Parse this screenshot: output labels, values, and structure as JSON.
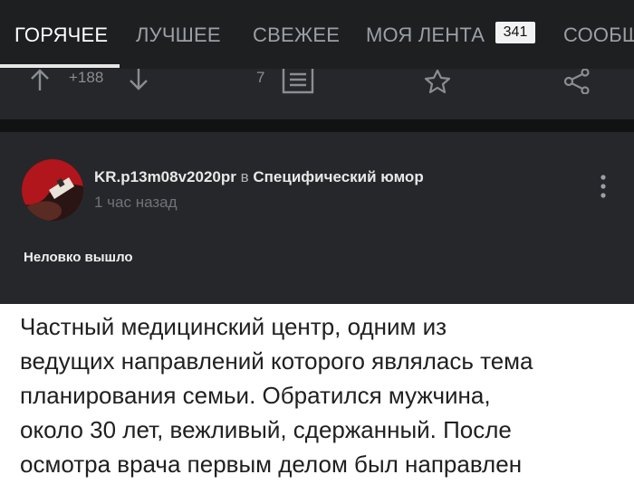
{
  "tabs": [
    {
      "label": "ГОРЯЧЕЕ"
    },
    {
      "label": "ЛУЧШЕЕ"
    },
    {
      "label": "СВЕЖЕЕ"
    },
    {
      "label": "МОЯ ЛЕНТА"
    },
    {
      "label": "СООБЩ"
    }
  ],
  "feed_badge": "341",
  "actions": {
    "rating": "+188",
    "comments": "7"
  },
  "post": {
    "author": "KR.p13m08v2020pr",
    "in_word": "в",
    "community": "Специфический юмор",
    "time": "1 час назад",
    "title": "Неловко вышло",
    "content_lines": [
      "Частный медицинский центр, одним из",
      "ведущих направлений которого являлась тема",
      "планирования семьи. Обратился мужчина,",
      "около 30 лет, вежливый, сдержанный. После",
      "осмотра врача первым делом был направлен"
    ]
  },
  "icons": {
    "upvote": "arrow-up-icon",
    "downvote": "arrow-down-icon",
    "comments": "comments-icon",
    "favorite": "star-icon",
    "share": "share-icon",
    "more": "more-vertical-icon"
  },
  "colors": {
    "background": "#202124",
    "active_tab": "#ffffff",
    "inactive_tab": "#9aa0a6"
  }
}
